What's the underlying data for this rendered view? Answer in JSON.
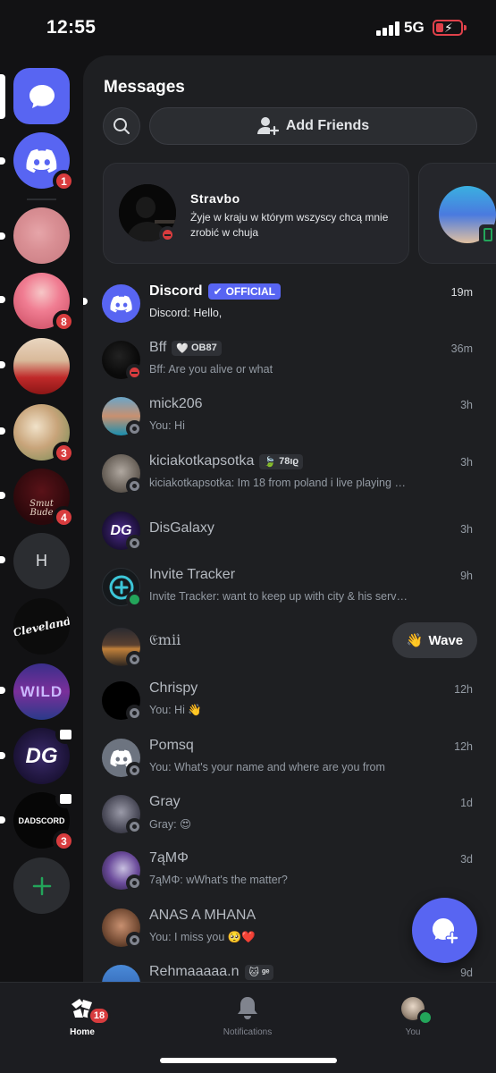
{
  "status": {
    "time": "12:55",
    "network": "5G"
  },
  "rail": {
    "servers": [
      {
        "name": "direct-messages",
        "badge": ""
      },
      {
        "name": "discord",
        "badge": "1"
      },
      {
        "name": "server-pink",
        "badge": ""
      },
      {
        "name": "server-anime-pink-hair",
        "badge": "8"
      },
      {
        "name": "server-red-dress",
        "badge": ""
      },
      {
        "name": "server-anime-couple",
        "badge": "3"
      },
      {
        "name": "server-smut",
        "badge": "4",
        "text": "Smut Bude"
      },
      {
        "name": "server-h",
        "badge": "",
        "text": "H"
      },
      {
        "name": "server-cleveland",
        "badge": "",
        "text": "Cleveland"
      },
      {
        "name": "server-wild",
        "badge": "",
        "text": "WILD"
      },
      {
        "name": "server-dg",
        "badge": "",
        "text": "DG"
      },
      {
        "name": "server-dadscord",
        "badge": "3",
        "text": "DADSCORD"
      }
    ]
  },
  "main": {
    "title": "Messages",
    "add_friends": "Add Friends",
    "card": {
      "name": "Stravbo",
      "status": "Żyje w kraju w którym wszyscy chcą mnie zrobić w chuja"
    },
    "dms": [
      {
        "name": "Discord",
        "tag": "OFFICIAL",
        "preview": "Discord: Hello,",
        "time": "19m"
      },
      {
        "name": "Bff",
        "tag": "OB87",
        "preview": "Bff: Are you alive or what",
        "time": "36m"
      },
      {
        "name": "mick206",
        "tag": "",
        "preview": "You: Hi",
        "time": "3h"
      },
      {
        "name": "kiciakotkapsotka",
        "tag": "78ıϱ",
        "preview": "kiciakotkapsotka: Im 18 from poland i live playing games running...",
        "time": "3h"
      },
      {
        "name": "DisGalaxy",
        "tag": "",
        "preview": "",
        "time": "3h"
      },
      {
        "name": "Invite Tracker",
        "tag": "",
        "preview": "Invite Tracker: want to keep up with city & his servers? Wanna m...",
        "time": "9h"
      },
      {
        "name": "𝔈mii",
        "tag": "",
        "preview": "",
        "time": "",
        "wave": "Wave"
      },
      {
        "name": "Chrispy",
        "tag": "",
        "preview": "You: Hi 👋",
        "time": "12h"
      },
      {
        "name": "Pomsq",
        "tag": "",
        "preview": "You: What's your name and where are you from",
        "time": "12h"
      },
      {
        "name": "Gray",
        "tag": "",
        "preview": "Gray: 😍",
        "time": "1d"
      },
      {
        "name": "7ąMΦ",
        "tag": "",
        "preview": "7ąMΦ: wWhat's the matter?",
        "time": "3d"
      },
      {
        "name": "ANAS A MHANA",
        "tag": "",
        "preview": "You: I miss you 🥺❤️",
        "time": ""
      },
      {
        "name": "Rehmaaaaa.n",
        "tag": "🐱 ᵍᵉ",
        "preview": "",
        "time": "9d"
      }
    ]
  },
  "nav": {
    "home": "Home",
    "home_badge": "18",
    "notifications": "Notifications",
    "you": "You"
  }
}
